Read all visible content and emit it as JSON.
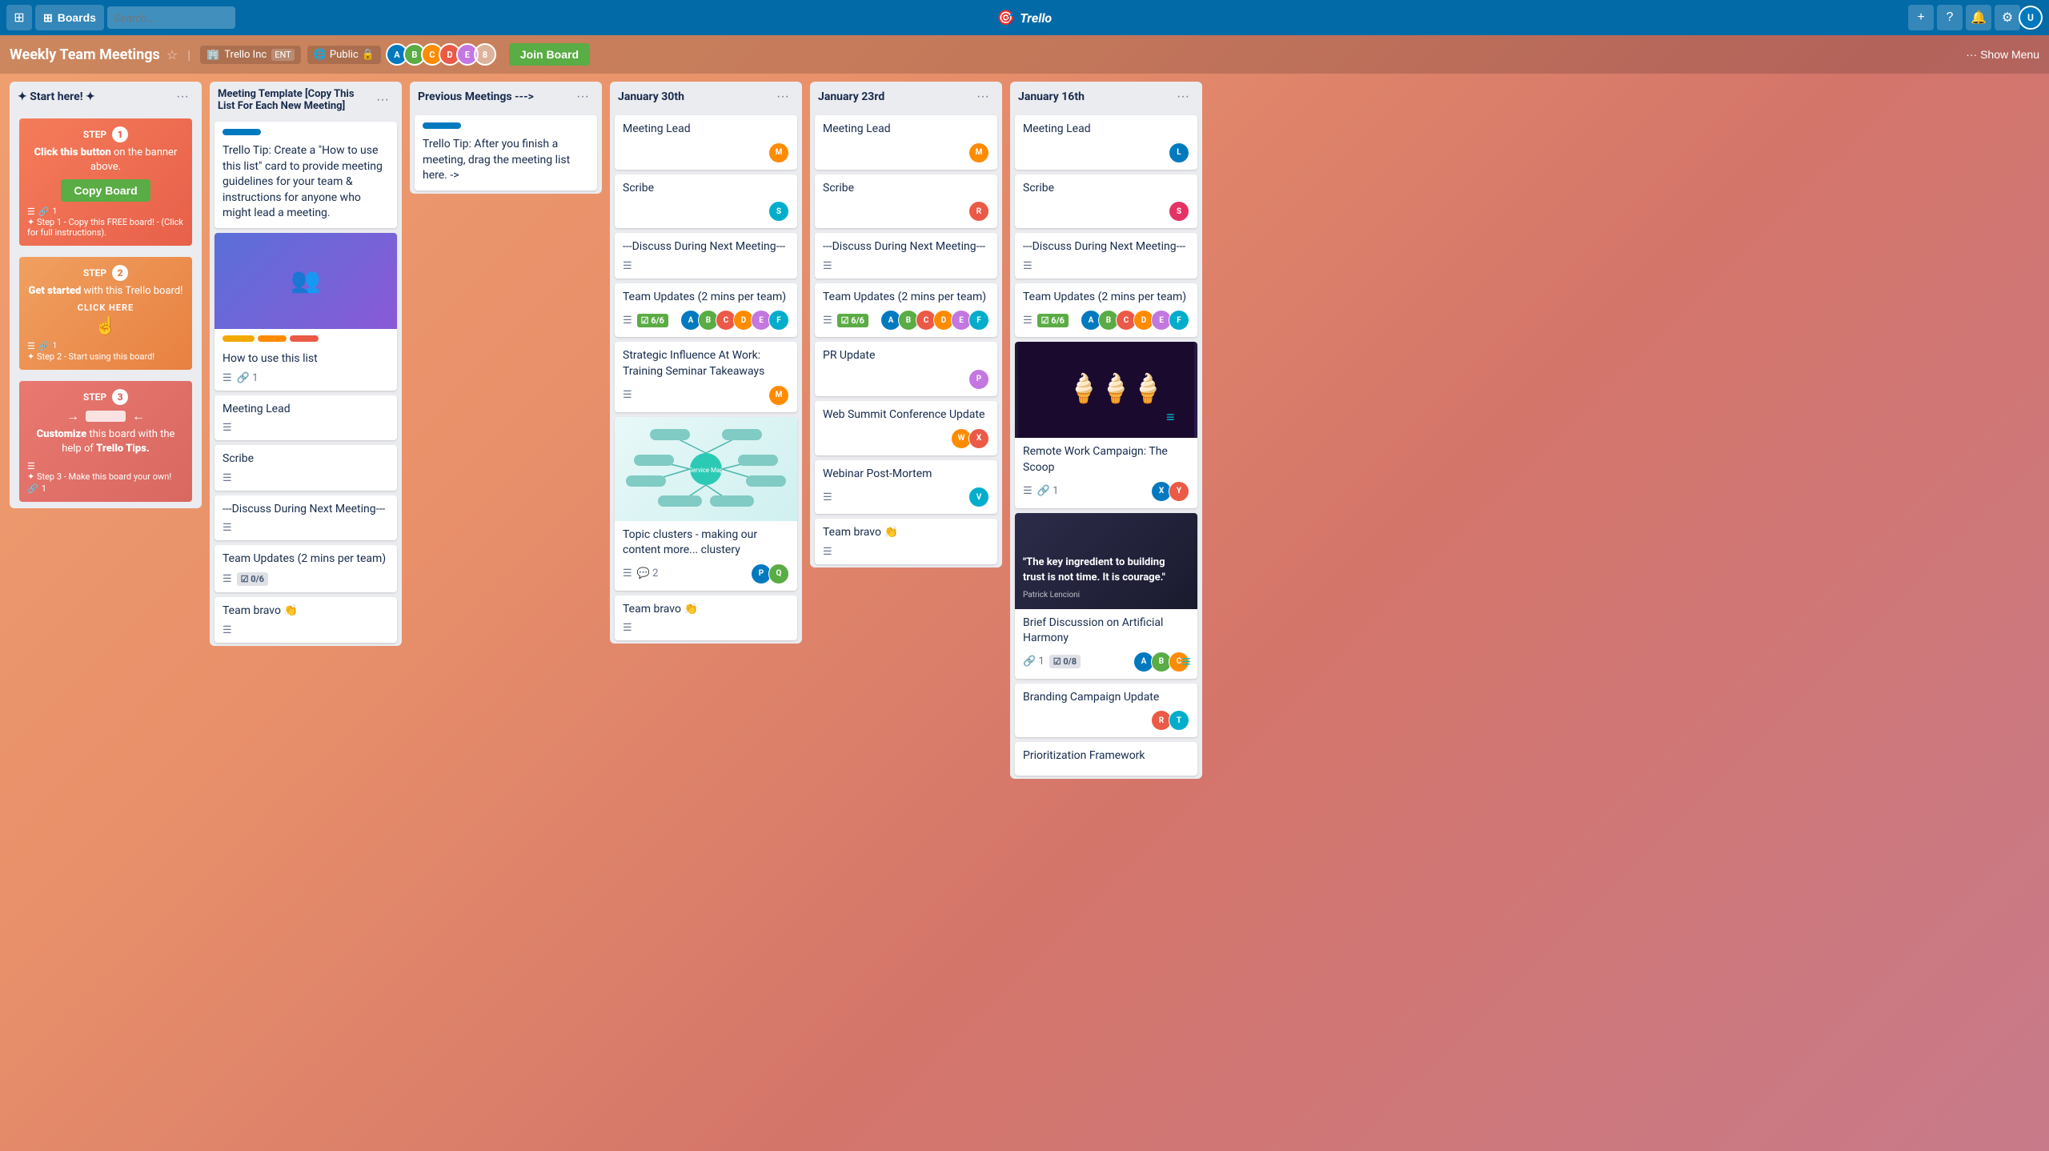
{
  "header": {
    "home_icon": "⊞",
    "boards_label": "Boards",
    "search_placeholder": "Search...",
    "logo": "Trello",
    "add_icon": "+",
    "info_icon": "?",
    "notification_icon": "🔔",
    "settings_icon": "⚙",
    "show_menu_label": "... Show Menu"
  },
  "board": {
    "title": "Weekly Team Meetings",
    "workspace": "Trello Inc",
    "workspace_tag": "ENT",
    "visibility": "Public",
    "join_board_label": "Join Board",
    "member_count": "8"
  },
  "lists": [
    {
      "id": "start-here",
      "title": "✦ Start here! ✦",
      "menu_icon": "···",
      "step_cards": [
        {
          "step": 1,
          "headline_1": "Click this button",
          "headline_2": "on the banner above.",
          "button_label": "Copy Board",
          "footnote": "✦ Step 1 - Copy this FREE board! - (Click for full instructions)."
        },
        {
          "step": 2,
          "headline_1": "Get started",
          "headline_2": "with this Trello board!",
          "link_label": "CLICK HERE",
          "footnote": "✦ Step 2 - Start using this board!"
        },
        {
          "step": 3,
          "headline_1": "Customize",
          "headline_2": "this board with the help of",
          "emphasis": "Trello Tips.",
          "footnote": "✦ Step 3 - Make this board your own!"
        }
      ]
    },
    {
      "id": "meeting-template",
      "title": "Meeting Template [Copy This List For Each New Meeting]",
      "menu_icon": "···",
      "cards": [
        {
          "id": "trello-tip",
          "has_label": true,
          "label_type": "blue",
          "title": "Trello Tip: Create a \"How to use this list\" card to provide meeting guidelines for your team & instructions for anyone who might lead a meeting.",
          "meta": {}
        },
        {
          "id": "how-to-use",
          "has_image": true,
          "image_type": "purple-meeting",
          "labels": [
            "yellow",
            "orange",
            "red"
          ],
          "title": "How to use this list",
          "meta": {
            "desc": true,
            "count": "1"
          }
        },
        {
          "id": "meeting-lead-template",
          "title": "Meeting Lead",
          "meta": {
            "desc": true
          }
        },
        {
          "id": "scribe-template",
          "title": "Scribe",
          "meta": {
            "desc": true
          }
        },
        {
          "id": "discuss-template",
          "title": "---Discuss During Next Meeting---",
          "meta": {
            "desc": true
          }
        },
        {
          "id": "team-updates-template",
          "title": "Team Updates (2 mins per team)",
          "meta": {
            "desc": true,
            "checklist": "0/6"
          }
        },
        {
          "id": "team-bravo-template",
          "title": "Team bravo 👏",
          "meta": {
            "desc": true
          }
        }
      ]
    },
    {
      "id": "previous-meetings",
      "title": "Previous Meetings --->",
      "menu_icon": "···",
      "cards": [
        {
          "id": "prev-tip",
          "has_label": true,
          "label_type": "blue",
          "title": "Trello Tip: After you finish a meeting, drag the meeting list here. ->",
          "meta": {}
        }
      ]
    },
    {
      "id": "jan30",
      "title": "January 30th",
      "menu_icon": "···",
      "cards": [
        {
          "id": "jan30-lead",
          "title": "Meeting Lead",
          "meta": {
            "avatars": [
              "brown1"
            ]
          }
        },
        {
          "id": "jan30-scribe",
          "title": "Scribe",
          "meta": {
            "avatars": [
              "brown2"
            ]
          }
        },
        {
          "id": "jan30-discuss",
          "title": "---Discuss During Next Meeting---",
          "meta": {
            "desc": true
          }
        },
        {
          "id": "jan30-updates",
          "title": "Team Updates (2 mins per team)",
          "meta": {
            "desc": true,
            "checklist_green": "6/6",
            "avatars": [
              "av1",
              "av2",
              "av3",
              "av4",
              "av5",
              "av6"
            ]
          }
        },
        {
          "id": "jan30-strategic",
          "title": "Strategic Influence At Work: Training Seminar Takeaways",
          "meta": {
            "desc": true,
            "avatars": [
              "brown3"
            ]
          }
        },
        {
          "id": "jan30-topic",
          "has_mindmap": true,
          "title": "Topic clusters - making our content more... clustery",
          "meta": {
            "desc": true,
            "comment": "2",
            "avatars": [
              "av7",
              "av8"
            ]
          }
        },
        {
          "id": "jan30-bravo",
          "title": "Team bravo 👏",
          "meta": {
            "desc": true
          }
        }
      ]
    },
    {
      "id": "jan23",
      "title": "January 23rd",
      "menu_icon": "···",
      "cards": [
        {
          "id": "jan23-lead",
          "title": "Meeting Lead",
          "meta": {
            "avatars": [
              "brown4"
            ]
          }
        },
        {
          "id": "jan23-scribe",
          "title": "Scribe",
          "meta": {
            "avatars": [
              "brown5"
            ]
          }
        },
        {
          "id": "jan23-discuss",
          "title": "---Discuss During Next Meeting---",
          "meta": {
            "desc": true
          }
        },
        {
          "id": "jan23-updates",
          "title": "Team Updates (2 mins per team)",
          "meta": {
            "desc": true,
            "checklist_green": "6/6",
            "avatars": [
              "av9",
              "av10",
              "av11",
              "av12",
              "av13",
              "av14"
            ]
          }
        },
        {
          "id": "jan23-pr",
          "title": "PR Update",
          "meta": {
            "avatars": [
              "brown6"
            ]
          }
        },
        {
          "id": "jan23-websummit",
          "title": "Web Summit Conference Update",
          "meta": {
            "avatars": [
              "brown7",
              "brown8"
            ]
          }
        },
        {
          "id": "jan23-webinar",
          "title": "Webinar Post-Mortem",
          "meta": {
            "desc": true,
            "avatars": [
              "brown9"
            ]
          }
        },
        {
          "id": "jan23-bravo",
          "title": "Team bravo 👏",
          "meta": {
            "desc": true
          }
        }
      ]
    },
    {
      "id": "jan16",
      "title": "January 16th",
      "menu_icon": "···",
      "cards": [
        {
          "id": "jan16-lead",
          "title": "Meeting Lead",
          "meta": {
            "avatars": [
              "brown10"
            ]
          }
        },
        {
          "id": "jan16-scribe",
          "title": "Scribe",
          "meta": {
            "avatars": [
              "brown11"
            ]
          }
        },
        {
          "id": "jan16-discuss",
          "title": "---Discuss During Next Meeting---",
          "meta": {
            "desc": true
          }
        },
        {
          "id": "jan16-updates",
          "title": "Team Updates (2 mins per team)",
          "meta": {
            "desc": true,
            "checklist_green": "6/6",
            "avatars": [
              "av15",
              "av16",
              "av17",
              "av18",
              "av19",
              "av20"
            ]
          }
        },
        {
          "id": "jan16-icecream",
          "has_icecream": true,
          "title": "Remote Work Campaign: The Scoop",
          "meta": {
            "desc": true,
            "count": "1",
            "avatars": [
              "avA",
              "avB"
            ]
          }
        },
        {
          "id": "jan16-trust",
          "has_trust": true,
          "title": "Brief Discussion on Artificial Harmony",
          "meta": {
            "count": "1",
            "checklist": "0/8",
            "avatars": [
              "avC",
              "avD",
              "avE"
            ]
          }
        },
        {
          "id": "jan16-branding",
          "title": "Branding Campaign Update",
          "meta": {
            "avatars": [
              "avF",
              "avG"
            ]
          }
        },
        {
          "id": "jan16-prioritization",
          "title": "Prioritization Framework",
          "meta": {}
        }
      ]
    }
  ]
}
